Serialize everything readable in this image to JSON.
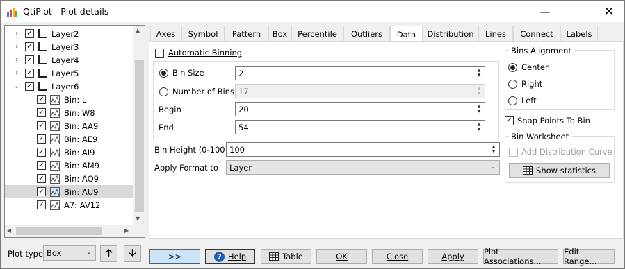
{
  "window": {
    "title": "QtiPlot - Plot details",
    "controls": [
      "minimize",
      "maximize",
      "close"
    ]
  },
  "tree": {
    "items": [
      {
        "label": "Layer2",
        "type": "layer",
        "expander": "›",
        "checked": true
      },
      {
        "label": "Layer3",
        "type": "layer",
        "expander": "›",
        "checked": true
      },
      {
        "label": "Layer4",
        "type": "layer",
        "expander": "›",
        "checked": true
      },
      {
        "label": "Layer5",
        "type": "layer",
        "expander": "›",
        "checked": true
      },
      {
        "label": "Layer6",
        "type": "layer",
        "expander": "⌄",
        "checked": true
      },
      {
        "label": "Bin: L",
        "type": "curve",
        "checked": true
      },
      {
        "label": "Bin: W8",
        "type": "curve",
        "checked": true
      },
      {
        "label": "Bin: AA9",
        "type": "curve",
        "checked": true
      },
      {
        "label": "Bin: AE9",
        "type": "curve",
        "checked": true
      },
      {
        "label": "Bin: AI9",
        "type": "curve",
        "checked": true
      },
      {
        "label": "Bin: AM9",
        "type": "curve",
        "checked": true
      },
      {
        "label": "Bin: AQ9",
        "type": "curve",
        "checked": true
      },
      {
        "label": "Bin: AU9",
        "type": "curve",
        "checked": true,
        "selected": true
      },
      {
        "label": "A7: AV12",
        "type": "curve",
        "checked": true
      }
    ]
  },
  "tabs": [
    "Axes",
    "Symbol",
    "Pattern",
    "Box",
    "Percentile",
    "Outliers",
    "Data",
    "Distribution",
    "Lines",
    "Connect",
    "Labels"
  ],
  "active_tab": "Data",
  "data_tab": {
    "automatic_binning": {
      "label": "Automatic Binning",
      "checked": false
    },
    "bin_size": {
      "label": "Bin Size",
      "value": "2",
      "selected": true
    },
    "number_of_bins": {
      "label": "Number of Bins",
      "value": "17",
      "selected": false
    },
    "begin": {
      "label": "Begin",
      "value": "20"
    },
    "end": {
      "label": "End",
      "value": "54"
    },
    "bin_height": {
      "label": "Bin Height (0-100)",
      "value": "100"
    },
    "apply_format": {
      "label": "Apply Format to",
      "value": "Layer"
    },
    "bins_alignment": {
      "title": "Bins Alignment",
      "options": [
        {
          "label": "Center",
          "selected": true
        },
        {
          "label": "Right",
          "selected": false
        },
        {
          "label": "Left",
          "selected": false
        }
      ]
    },
    "snap_points": {
      "label": "Snap Points To Bin",
      "checked": true
    },
    "bin_worksheet": {
      "title": "Bin Worksheet",
      "add_distribution_curve": {
        "label": "Add Distribution Curve",
        "checked": false,
        "enabled": false
      },
      "show_statistics": "Show statistics"
    }
  },
  "bottom": {
    "plot_type_label": "Plot type",
    "plot_type_value": "Box",
    "buttons": {
      "more": ">>",
      "help": "Help",
      "table": "Table",
      "ok": "OK",
      "close": "Close",
      "apply": "Apply",
      "plot_associations": "Plot Associations...",
      "edit_range": "Edit Range..."
    }
  },
  "colors": {
    "accent": "#0078d7",
    "default_button": "#cce4f7",
    "selected_row": "#d9d9d9"
  }
}
